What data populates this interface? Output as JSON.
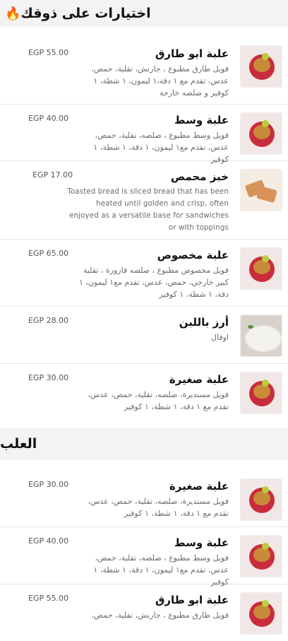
{
  "sections": [
    {
      "title": "اختيارات على ذوقك",
      "icon": "flame-icon"
    },
    {
      "title": "العلب"
    }
  ],
  "items": [
    {
      "title": "علبة ابو طارق",
      "desc": "فويل طارق مطبوع ، جارنش، تقلية، حمص، عدس، تقدم مع ١ دقة،١ ليمون، ١ شطة، ١ كوفير و صلصه خارجة",
      "price": "EGP 55.00"
    },
    {
      "title": "علبة وسط",
      "desc": "فويل وسط مطبوع ، صلصه، تقلية، حمص، عدس، تقدم مع١ ليمون، ١ دقة، ١ شطة، ١ كوفير",
      "price": "EGP 40.00"
    },
    {
      "title": "خبز محمص",
      "desc": "Toasted bread is sliced bread that has been heated until golden and crisp, often enjoyed as a versatile base for sandwiches or with toppings",
      "price": "EGP 17.00"
    },
    {
      "title": "علبة مخصوص",
      "desc": "فويل مخصوص مطبوع ، صلصه قارورة ، تقلية كبير خارجي، حمص، عدس، تقدم مع١ ليمون، ١ دقة، ١ شطة، ١ كوفير",
      "price": "EGP 65.00"
    },
    {
      "title": "أرز باللبن",
      "desc": "اوفال",
      "price": "EGP 28.00"
    },
    {
      "title": "علبة صغيرة",
      "desc": "فويل مستديرة، صلصه، تقلية، حمص، عدس، تقدم مع ١ دقة، ١ شطة، ١ كوفير",
      "price": "EGP 30.00"
    },
    {
      "title": "علبة صغيرة",
      "desc": "فويل مستديرة، صلصه، تقلية، حمص، عدس، تقدم مع ١ دقة، ١ شطة، ١ كوفير",
      "price": "EGP 30.00"
    },
    {
      "title": "علبة وسط",
      "desc": "فويل وسط مطبوع ، صلصه، تقلية، حمص، عدس، تقدم مع١ ليمون، ١ دقة، ١ شطة، ١ كوفير",
      "price": "EGP 40.00"
    },
    {
      "title": "علبة ابو طارق",
      "desc": "فويل طارق مطبوع ، جارنش، تقلية، حمص،",
      "price": "EGP 55.00"
    }
  ],
  "colors": {
    "header_bg": "#f3f3f3",
    "price": "#555555",
    "desc": "#6b6b6b"
  }
}
